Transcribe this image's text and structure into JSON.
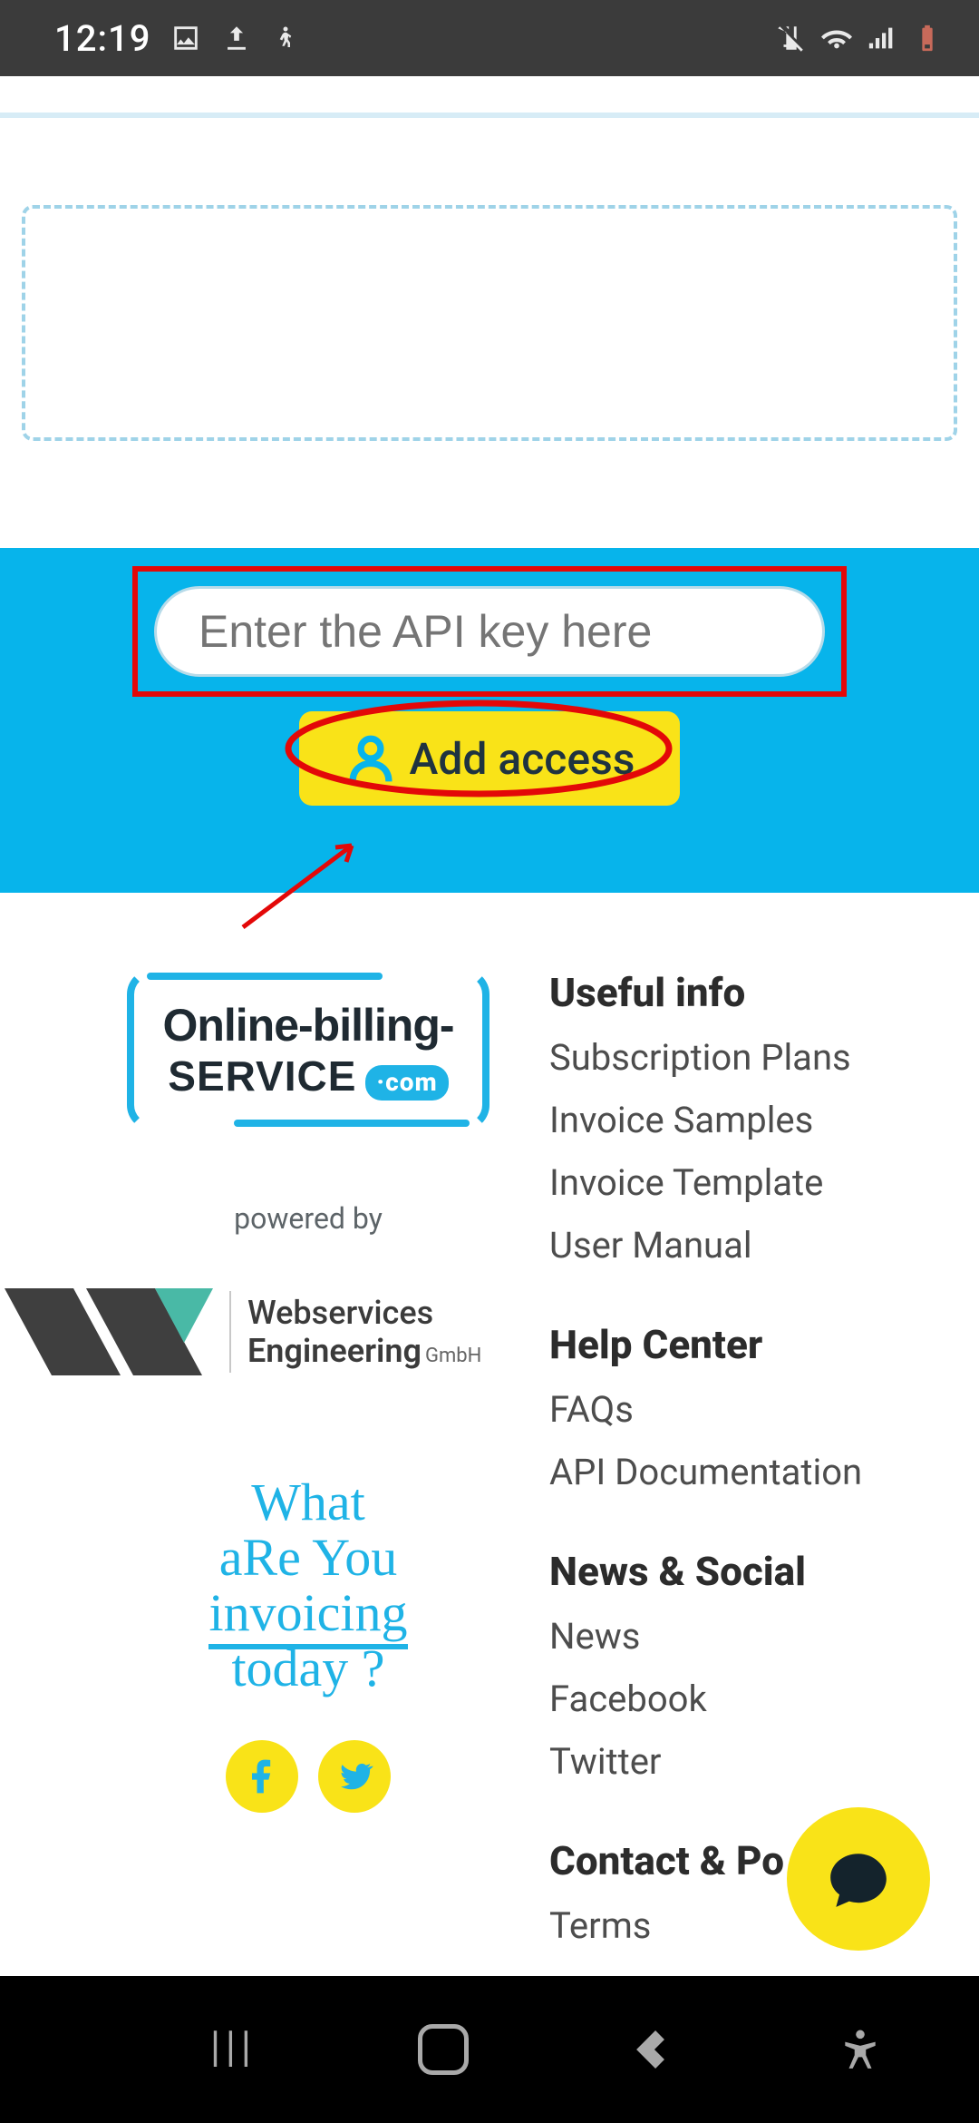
{
  "status_bar": {
    "time": "12:19"
  },
  "api": {
    "placeholder": "Enter the API key here",
    "add_access_label": "Add access"
  },
  "footer": {
    "logo_line1": "Online-billing-",
    "logo_service": "SERVICE",
    "logo_com": "·com",
    "powered_by": "powered by",
    "we_line1": "Webservices",
    "we_line2": "Engineering",
    "we_gmbh": "GmbH",
    "tagline_l1": "What",
    "tagline_l2": "aRe You",
    "tagline_l3": "invoicing",
    "tagline_l4": "today ?",
    "sections": {
      "useful_info": {
        "heading": "Useful info",
        "links": [
          "Subscription Plans",
          "Invoice Samples",
          "Invoice Template",
          "User Manual"
        ]
      },
      "help_center": {
        "heading": "Help Center",
        "links": [
          "FAQs",
          "API Documentation"
        ]
      },
      "news_social": {
        "heading": "News & Social",
        "links": [
          "News",
          "Facebook",
          "Twitter"
        ]
      },
      "contact": {
        "heading": "Contact & Po",
        "links": [
          "Terms"
        ]
      }
    }
  }
}
